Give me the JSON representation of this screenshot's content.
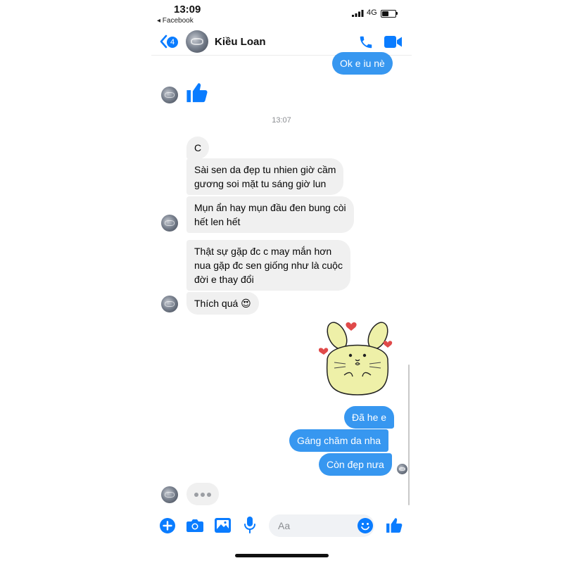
{
  "status_bar": {
    "time": "13:09",
    "back_app": "◂ Facebook",
    "network": "4G",
    "battery_fraction": 0.5
  },
  "header": {
    "back_badge_count": "4",
    "contact_name": "Kiều Loan",
    "icons": [
      "chevron-left-icon",
      "phone-icon",
      "video-camera-icon"
    ]
  },
  "colors": {
    "accent": "#0a7cff",
    "outgoing_bubble": "#3797f0",
    "incoming_bubble": "#f0f0f0",
    "timestamp_text": "#8a8d91"
  },
  "messages": {
    "out_top": "Ok e iu nè",
    "like_reaction": "thumbs-up-icon",
    "timestamp": "13:07",
    "in_1": "C",
    "in_2_line1": "Sài sen da đẹp tu nhien giờ cầm",
    "in_2_line2": "gương soi mặt tu sáng giờ lun",
    "in_3_line1": "Mụn ẩn hay mụn đầu đen bung còi",
    "in_3_line2": "hết len hết",
    "in_4_line1": "Thật sự gặp đc c may mắn hơn",
    "in_4_line2": "nua gặp đc sen giống như là cuộc",
    "in_4_line3": "đời e thay đổi",
    "in_5": "Thích quá 😍",
    "sticker": "cute-bunny-sticker",
    "out_1": "Đã he e",
    "out_2": "Gáng chăm da nha",
    "out_3": "Còn đẹp nưa"
  },
  "typing_indicator": "•••",
  "composer": {
    "placeholder": "Aa",
    "icons": [
      "plus-icon",
      "camera-icon",
      "image-icon",
      "microphone-icon",
      "emoji-icon",
      "thumbs-up-icon"
    ]
  }
}
